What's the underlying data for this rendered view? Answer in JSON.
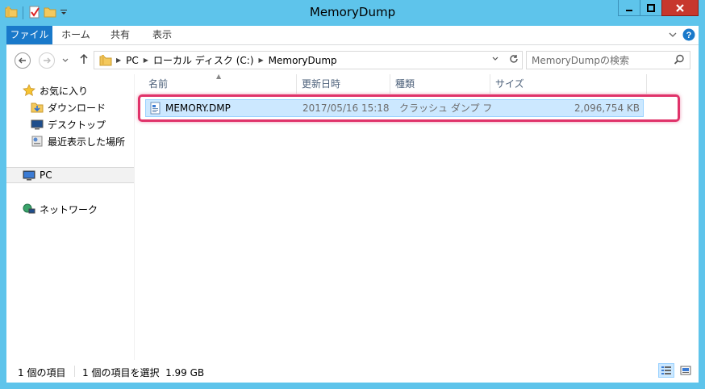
{
  "window": {
    "title": "MemoryDump"
  },
  "ribbon": {
    "tabs": [
      "ファイル",
      "ホーム",
      "共有",
      "表示"
    ]
  },
  "nav": {
    "breadcrumbs": [
      "PC",
      "ローカル ディスク (C:)",
      "MemoryDump"
    ],
    "search_placeholder": "MemoryDumpの検索"
  },
  "sidebar": {
    "favorites_label": "お気に入り",
    "favorites": [
      "ダウンロード",
      "デスクトップ",
      "最近表示した場所"
    ],
    "pc_label": "PC",
    "network_label": "ネットワーク"
  },
  "files": {
    "columns": [
      "名前",
      "更新日時",
      "種類",
      "サイズ"
    ],
    "rows": [
      {
        "name": "MEMORY.DMP",
        "modified": "2017/05/16 15:18",
        "type": "クラッシュ ダンプ ファ...",
        "size": "2,096,754 KB"
      }
    ]
  },
  "status": {
    "item_count": "1 個の項目",
    "selection": "1 個の項目を選択  1.99 GB"
  },
  "colors": {
    "frame": "#5ec4eb",
    "file_tab": "#1979ca",
    "selection": "#cce8ff",
    "highlight": "#e0336a",
    "close": "#c7372d"
  }
}
